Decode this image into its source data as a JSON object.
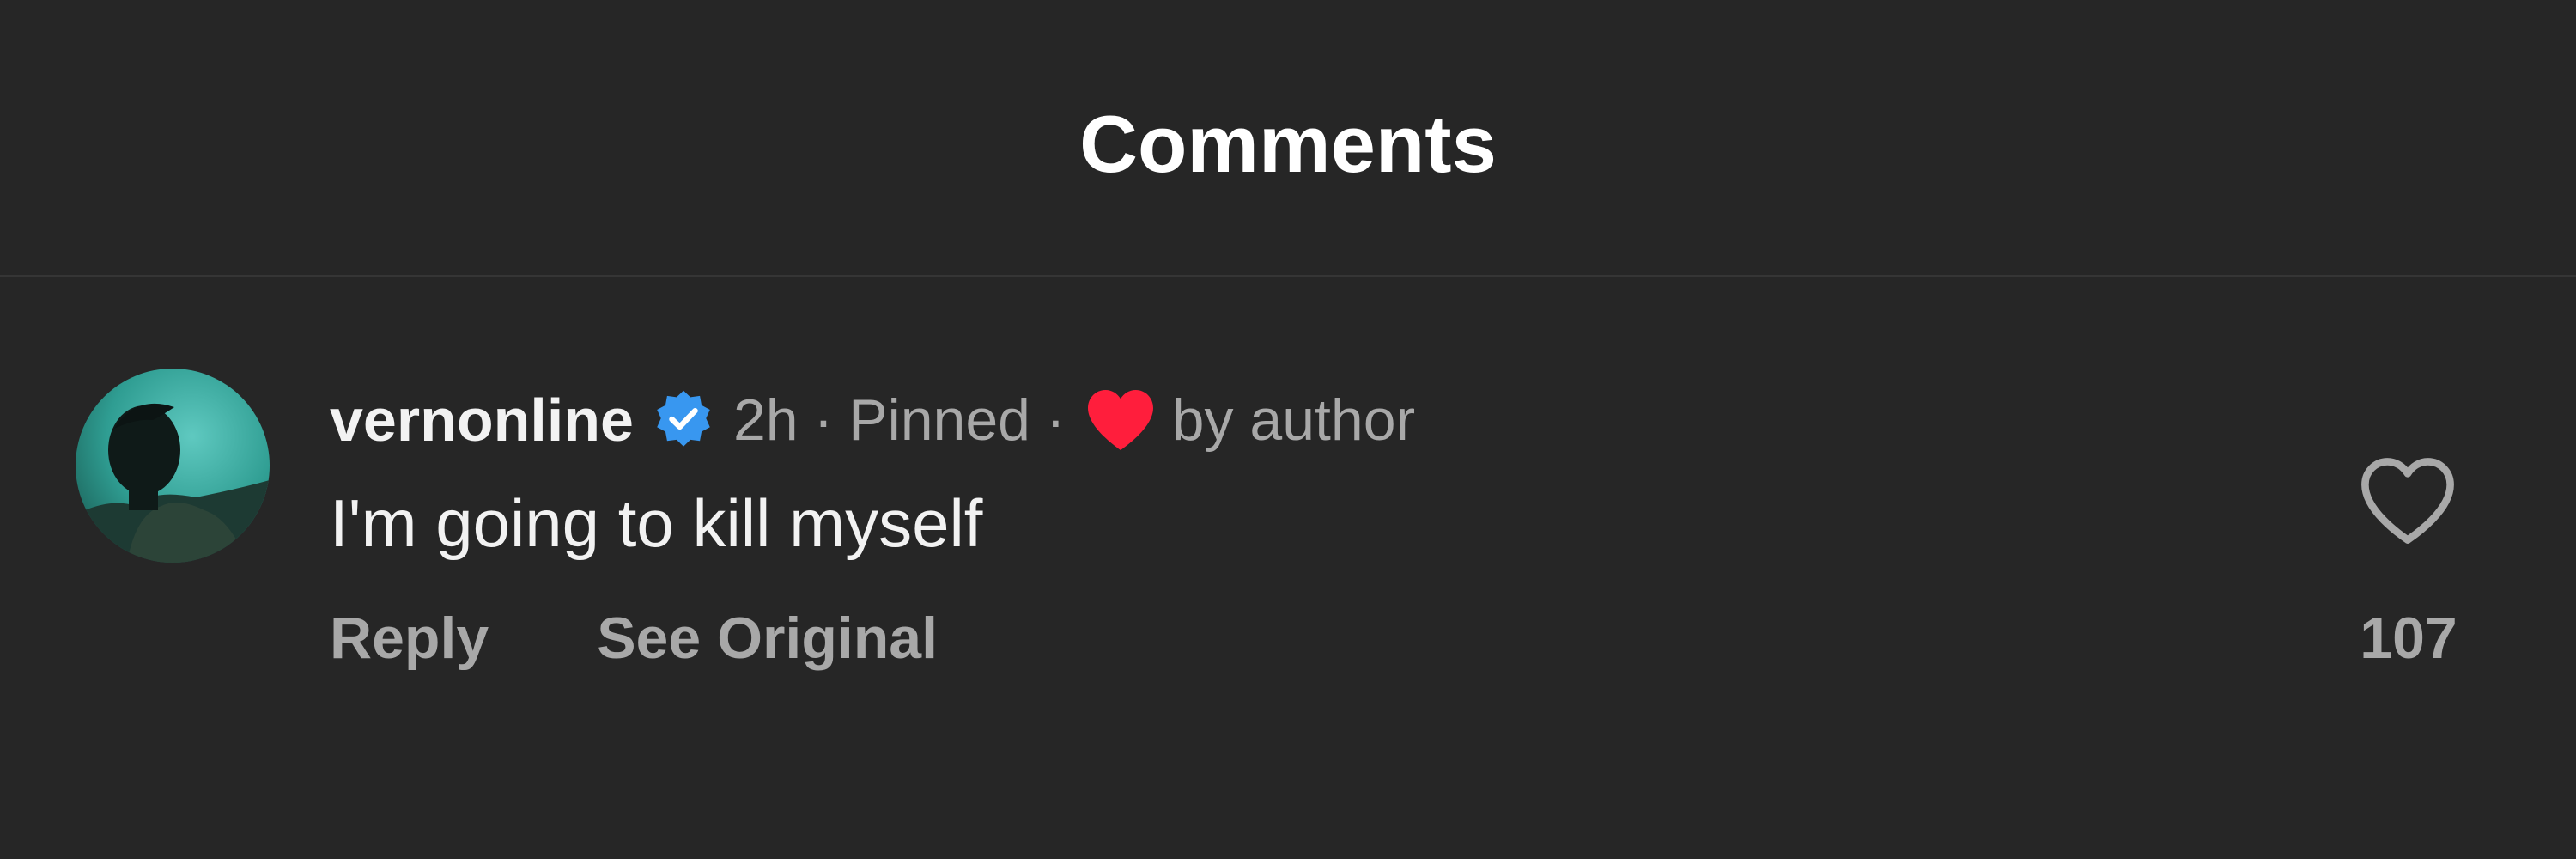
{
  "header": {
    "title": "Comments"
  },
  "comment": {
    "username": "vernonline",
    "verified": true,
    "time": "2h",
    "separator": "·",
    "pinned_label": "Pinned",
    "liked_by_label": "by author",
    "text": "I'm going to kill myself",
    "actions": {
      "reply_label": "Reply",
      "see_original_label": "See Original"
    },
    "like_count": "107",
    "icons": {
      "avatar": "user-avatar",
      "verified": "verified-badge-icon",
      "author_like": "red-heart-icon",
      "like": "heart-outline-icon"
    }
  },
  "colors": {
    "background": "#262626",
    "primary_text": "#ffffff",
    "secondary_text": "#a8a8a8",
    "verified_blue": "#3897f0",
    "heart_red": "#ff1e3c"
  }
}
